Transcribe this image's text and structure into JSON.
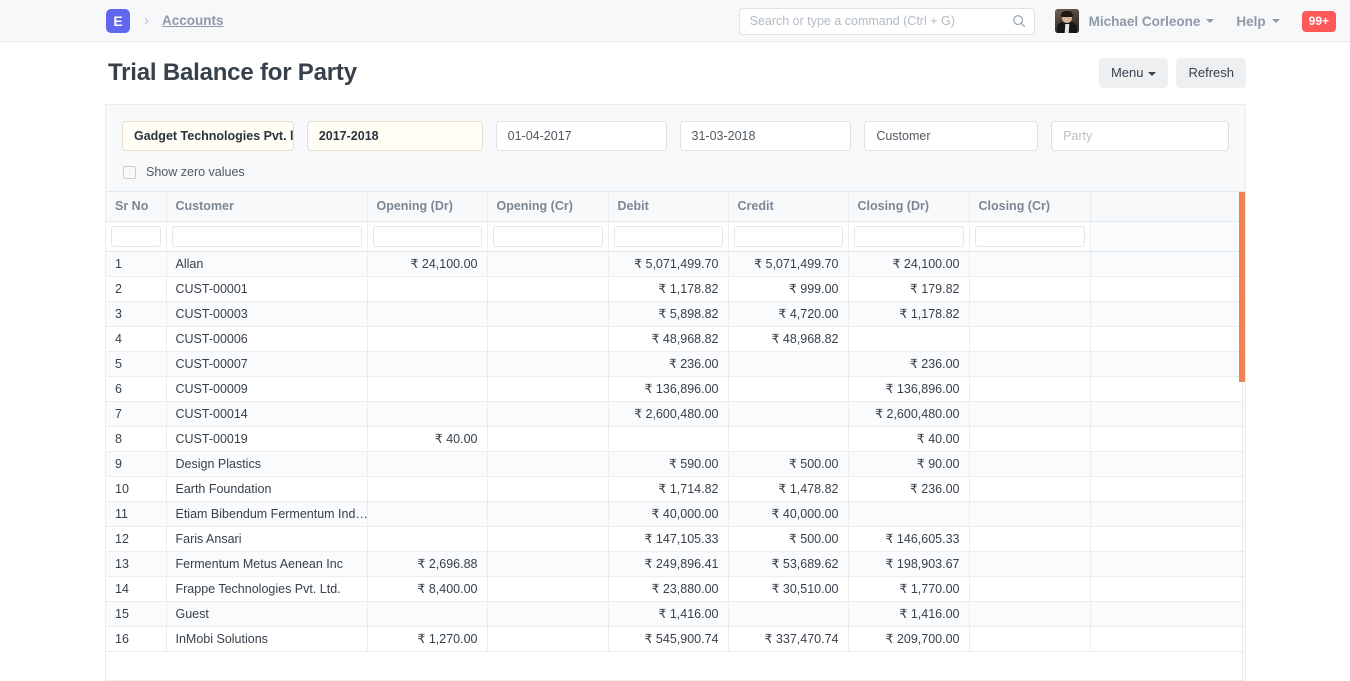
{
  "navbar": {
    "logo_text": "E",
    "breadcrumb": "Accounts",
    "search": {
      "placeholder": "Search or type a command (Ctrl + G)",
      "value": ""
    },
    "user_name": "Michael Corleone",
    "help_label": "Help",
    "notification_count": "99+"
  },
  "page": {
    "title": "Trial Balance for Party",
    "menu_label": "Menu",
    "refresh_label": "Refresh"
  },
  "filters": [
    {
      "value": "Gadget Technologies Pvt. l",
      "bold": true,
      "placeholder": ""
    },
    {
      "value": "2017-2018",
      "bold": true,
      "placeholder": ""
    },
    {
      "value": "01-04-2017",
      "bold": false,
      "placeholder": ""
    },
    {
      "value": "31-03-2018",
      "bold": false,
      "placeholder": ""
    },
    {
      "value": "Customer",
      "bold": false,
      "placeholder": ""
    },
    {
      "value": "",
      "bold": false,
      "placeholder": "Party"
    }
  ],
  "show_zero_values": {
    "label": "Show zero values",
    "checked": false
  },
  "table": {
    "columns": [
      "Sr No",
      "Customer",
      "Opening (Dr)",
      "Opening (Cr)",
      "Debit",
      "Credit",
      "Closing (Dr)",
      "Closing (Cr)"
    ],
    "column_filters": [
      "",
      "",
      "",
      "",
      "",
      "",
      "",
      ""
    ],
    "rows": [
      {
        "sr": "1",
        "customer": "Allan",
        "opening_dr": "₹ 24,100.00",
        "opening_cr": "",
        "debit": "₹ 5,071,499.70",
        "credit": "₹ 5,071,499.70",
        "closing_dr": "₹ 24,100.00",
        "closing_cr": ""
      },
      {
        "sr": "2",
        "customer": "CUST-00001",
        "opening_dr": "",
        "opening_cr": "",
        "debit": "₹ 1,178.82",
        "credit": "₹ 999.00",
        "closing_dr": "₹ 179.82",
        "closing_cr": ""
      },
      {
        "sr": "3",
        "customer": "CUST-00003",
        "opening_dr": "",
        "opening_cr": "",
        "debit": "₹ 5,898.82",
        "credit": "₹ 4,720.00",
        "closing_dr": "₹ 1,178.82",
        "closing_cr": ""
      },
      {
        "sr": "4",
        "customer": "CUST-00006",
        "opening_dr": "",
        "opening_cr": "",
        "debit": "₹ 48,968.82",
        "credit": "₹ 48,968.82",
        "closing_dr": "",
        "closing_cr": ""
      },
      {
        "sr": "5",
        "customer": "CUST-00007",
        "opening_dr": "",
        "opening_cr": "",
        "debit": "₹ 236.00",
        "credit": "",
        "closing_dr": "₹ 236.00",
        "closing_cr": ""
      },
      {
        "sr": "6",
        "customer": "CUST-00009",
        "opening_dr": "",
        "opening_cr": "",
        "debit": "₹ 136,896.00",
        "credit": "",
        "closing_dr": "₹ 136,896.00",
        "closing_cr": ""
      },
      {
        "sr": "7",
        "customer": "CUST-00014",
        "opening_dr": "",
        "opening_cr": "",
        "debit": "₹ 2,600,480.00",
        "credit": "",
        "closing_dr": "₹ 2,600,480.00",
        "closing_cr": ""
      },
      {
        "sr": "8",
        "customer": "CUST-00019",
        "opening_dr": "₹ 40.00",
        "opening_cr": "",
        "debit": "",
        "credit": "",
        "closing_dr": "₹ 40.00",
        "closing_cr": ""
      },
      {
        "sr": "9",
        "customer": "Design Plastics",
        "opening_dr": "",
        "opening_cr": "",
        "debit": "₹ 590.00",
        "credit": "₹ 500.00",
        "closing_dr": "₹ 90.00",
        "closing_cr": ""
      },
      {
        "sr": "10",
        "customer": "Earth Foundation",
        "opening_dr": "",
        "opening_cr": "",
        "debit": "₹ 1,714.82",
        "credit": "₹ 1,478.82",
        "closing_dr": "₹ 236.00",
        "closing_cr": ""
      },
      {
        "sr": "11",
        "customer": "Etiam Bibendum Fermentum Ind…",
        "opening_dr": "",
        "opening_cr": "",
        "debit": "₹ 40,000.00",
        "credit": "₹ 40,000.00",
        "closing_dr": "",
        "closing_cr": ""
      },
      {
        "sr": "12",
        "customer": "Faris Ansari",
        "opening_dr": "",
        "opening_cr": "",
        "debit": "₹ 147,105.33",
        "credit": "₹ 500.00",
        "closing_dr": "₹ 146,605.33",
        "closing_cr": ""
      },
      {
        "sr": "13",
        "customer": "Fermentum Metus Aenean Inc",
        "opening_dr": "₹ 2,696.88",
        "opening_cr": "",
        "debit": "₹ 249,896.41",
        "credit": "₹ 53,689.62",
        "closing_dr": "₹ 198,903.67",
        "closing_cr": ""
      },
      {
        "sr": "14",
        "customer": "Frappe Technologies Pvt. Ltd.",
        "opening_dr": "₹ 8,400.00",
        "opening_cr": "",
        "debit": "₹ 23,880.00",
        "credit": "₹ 30,510.00",
        "closing_dr": "₹ 1,770.00",
        "closing_cr": ""
      },
      {
        "sr": "15",
        "customer": "Guest",
        "opening_dr": "",
        "opening_cr": "",
        "debit": "₹ 1,416.00",
        "credit": "",
        "closing_dr": "₹ 1,416.00",
        "closing_cr": ""
      },
      {
        "sr": "16",
        "customer": "InMobi Solutions",
        "opening_dr": "₹ 1,270.00",
        "opening_cr": "",
        "debit": "₹ 545,900.74",
        "credit": "₹ 337,470.74",
        "closing_dr": "₹ 209,700.00",
        "closing_cr": ""
      }
    ]
  },
  "colors": {
    "accent": "#6366f1",
    "scrollbar": "#ef8354",
    "badge": "#ff5858",
    "highlight_filter_bg": "#fffdf4"
  }
}
